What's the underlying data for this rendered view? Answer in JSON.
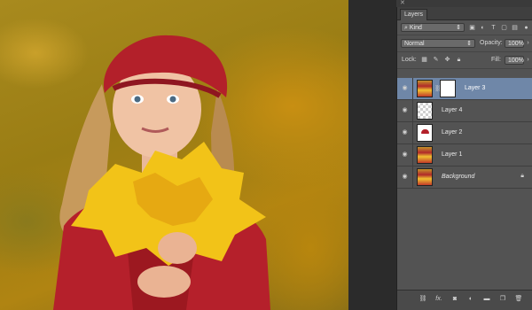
{
  "panel": {
    "close_glyph": "✕",
    "tab_label": "Layers",
    "filter": {
      "icon": "search-icon",
      "value": "Kind"
    },
    "blend_mode": "Normal",
    "opacity_label": "Opacity:",
    "opacity_value": "100%",
    "lock_label": "Lock:",
    "fill_label": "Fill:",
    "fill_value": "100%"
  },
  "layers": [
    {
      "name": "Layer 3",
      "selected": true,
      "has_mask": true,
      "thumb": "photo"
    },
    {
      "name": "Layer 4",
      "selected": false,
      "thumb": "transparent"
    },
    {
      "name": "Layer 2",
      "selected": false,
      "thumb": "hat"
    },
    {
      "name": "Layer 1",
      "selected": false,
      "thumb": "photo"
    },
    {
      "name": "Background",
      "selected": false,
      "thumb": "photo",
      "locked": true,
      "italic": true
    }
  ],
  "bottom_icons": [
    "link-icon",
    "fx-icon",
    "mask-icon",
    "adjustment-icon",
    "folder-icon",
    "new-layer-icon",
    "trash-icon"
  ],
  "fx_label": "fx.",
  "colors": {
    "panel_bg": "#535353",
    "selection": "#6f87a8",
    "app_bg": "#2b2b2b"
  }
}
